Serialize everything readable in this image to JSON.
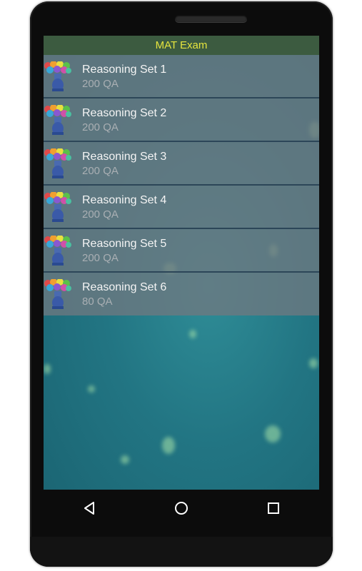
{
  "app": {
    "title": "MAT Exam"
  },
  "list": {
    "items": [
      {
        "title": "Reasoning Set 1",
        "subtitle": "200 QA",
        "icon": "rainbow-tree-head-icon"
      },
      {
        "title": "Reasoning Set 2",
        "subtitle": "200 QA",
        "icon": "rainbow-tree-head-icon"
      },
      {
        "title": "Reasoning Set 3",
        "subtitle": "200 QA",
        "icon": "rainbow-tree-head-icon"
      },
      {
        "title": "Reasoning Set 4",
        "subtitle": "200 QA",
        "icon": "rainbow-tree-head-icon"
      },
      {
        "title": "Reasoning Set 5",
        "subtitle": "200 QA",
        "icon": "rainbow-tree-head-icon"
      },
      {
        "title": "Reasoning Set 6",
        "subtitle": "80 QA",
        "icon": "rainbow-tree-head-icon"
      }
    ]
  },
  "navbar": {
    "icons": [
      "back-icon",
      "home-icon",
      "recents-icon"
    ]
  },
  "colors": {
    "appbar_bg": "#3c5b40",
    "appbar_text": "#e5e43e",
    "screen_bg": "#227583"
  }
}
